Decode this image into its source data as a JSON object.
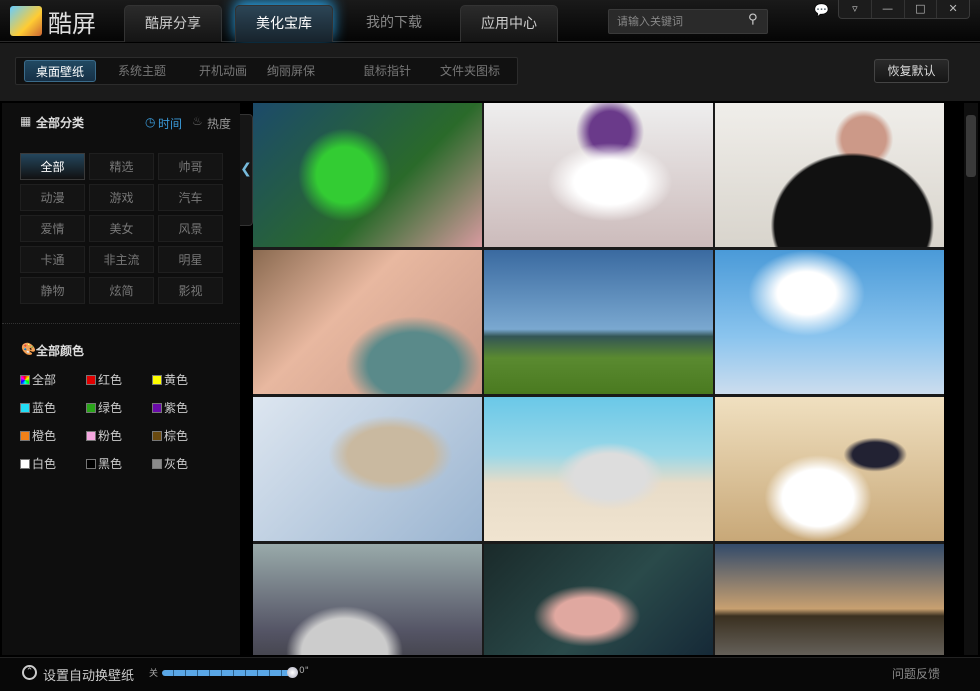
{
  "app": {
    "name": "酷屏"
  },
  "main_tabs": [
    {
      "label": "酷屏分享"
    },
    {
      "label": "美化宝库",
      "active": true
    },
    {
      "label": "我的下载"
    },
    {
      "label": "应用中心"
    }
  ],
  "search": {
    "placeholder": "请输入关键词",
    "icon": "search-icon"
  },
  "window_controls": [
    "menu",
    "minimize",
    "maximize",
    "close"
  ],
  "sub_tabs": [
    {
      "label": "桌面壁纸",
      "active": true
    },
    {
      "label": "系统主题"
    },
    {
      "label": "开机动画"
    },
    {
      "label": "绚丽屏保"
    },
    {
      "label": "鼠标指针"
    },
    {
      "label": "文件夹图标"
    }
  ],
  "reset_label": "恢复默认",
  "sidebar": {
    "category_title": "全部分类",
    "sort_time": "时间",
    "sort_hot": "热度",
    "categories": [
      "全部",
      "精选",
      "帅哥",
      "动漫",
      "游戏",
      "汽车",
      "爱情",
      "美女",
      "风景",
      "卡通",
      "非主流",
      "明星",
      "静物",
      "炫简",
      "影视"
    ],
    "color_title": "全部颜色",
    "colors": [
      {
        "label": "全部",
        "hex": "rainbow"
      },
      {
        "label": "红色",
        "hex": "#e00000"
      },
      {
        "label": "黄色",
        "hex": "#ffff00"
      },
      {
        "label": "蓝色",
        "hex": "#22ddf5"
      },
      {
        "label": "绿色",
        "hex": "#2aa51a"
      },
      {
        "label": "紫色",
        "hex": "#6a0aaa"
      },
      {
        "label": "橙色",
        "hex": "#f08018"
      },
      {
        "label": "粉色",
        "hex": "#f5a8e0"
      },
      {
        "label": "棕色",
        "hex": "#6a4a10"
      },
      {
        "label": "白色",
        "hex": "#ffffff"
      },
      {
        "label": "黑色",
        "hex": "#000000"
      },
      {
        "label": "灰色",
        "hex": "#8a8a8a"
      }
    ]
  },
  "footer": {
    "auto_change_label": "设置自动换壁纸",
    "slider_min": "关",
    "slider_value": "0\"",
    "slider_fraction": 1.0,
    "feedback": "问题反馈"
  }
}
